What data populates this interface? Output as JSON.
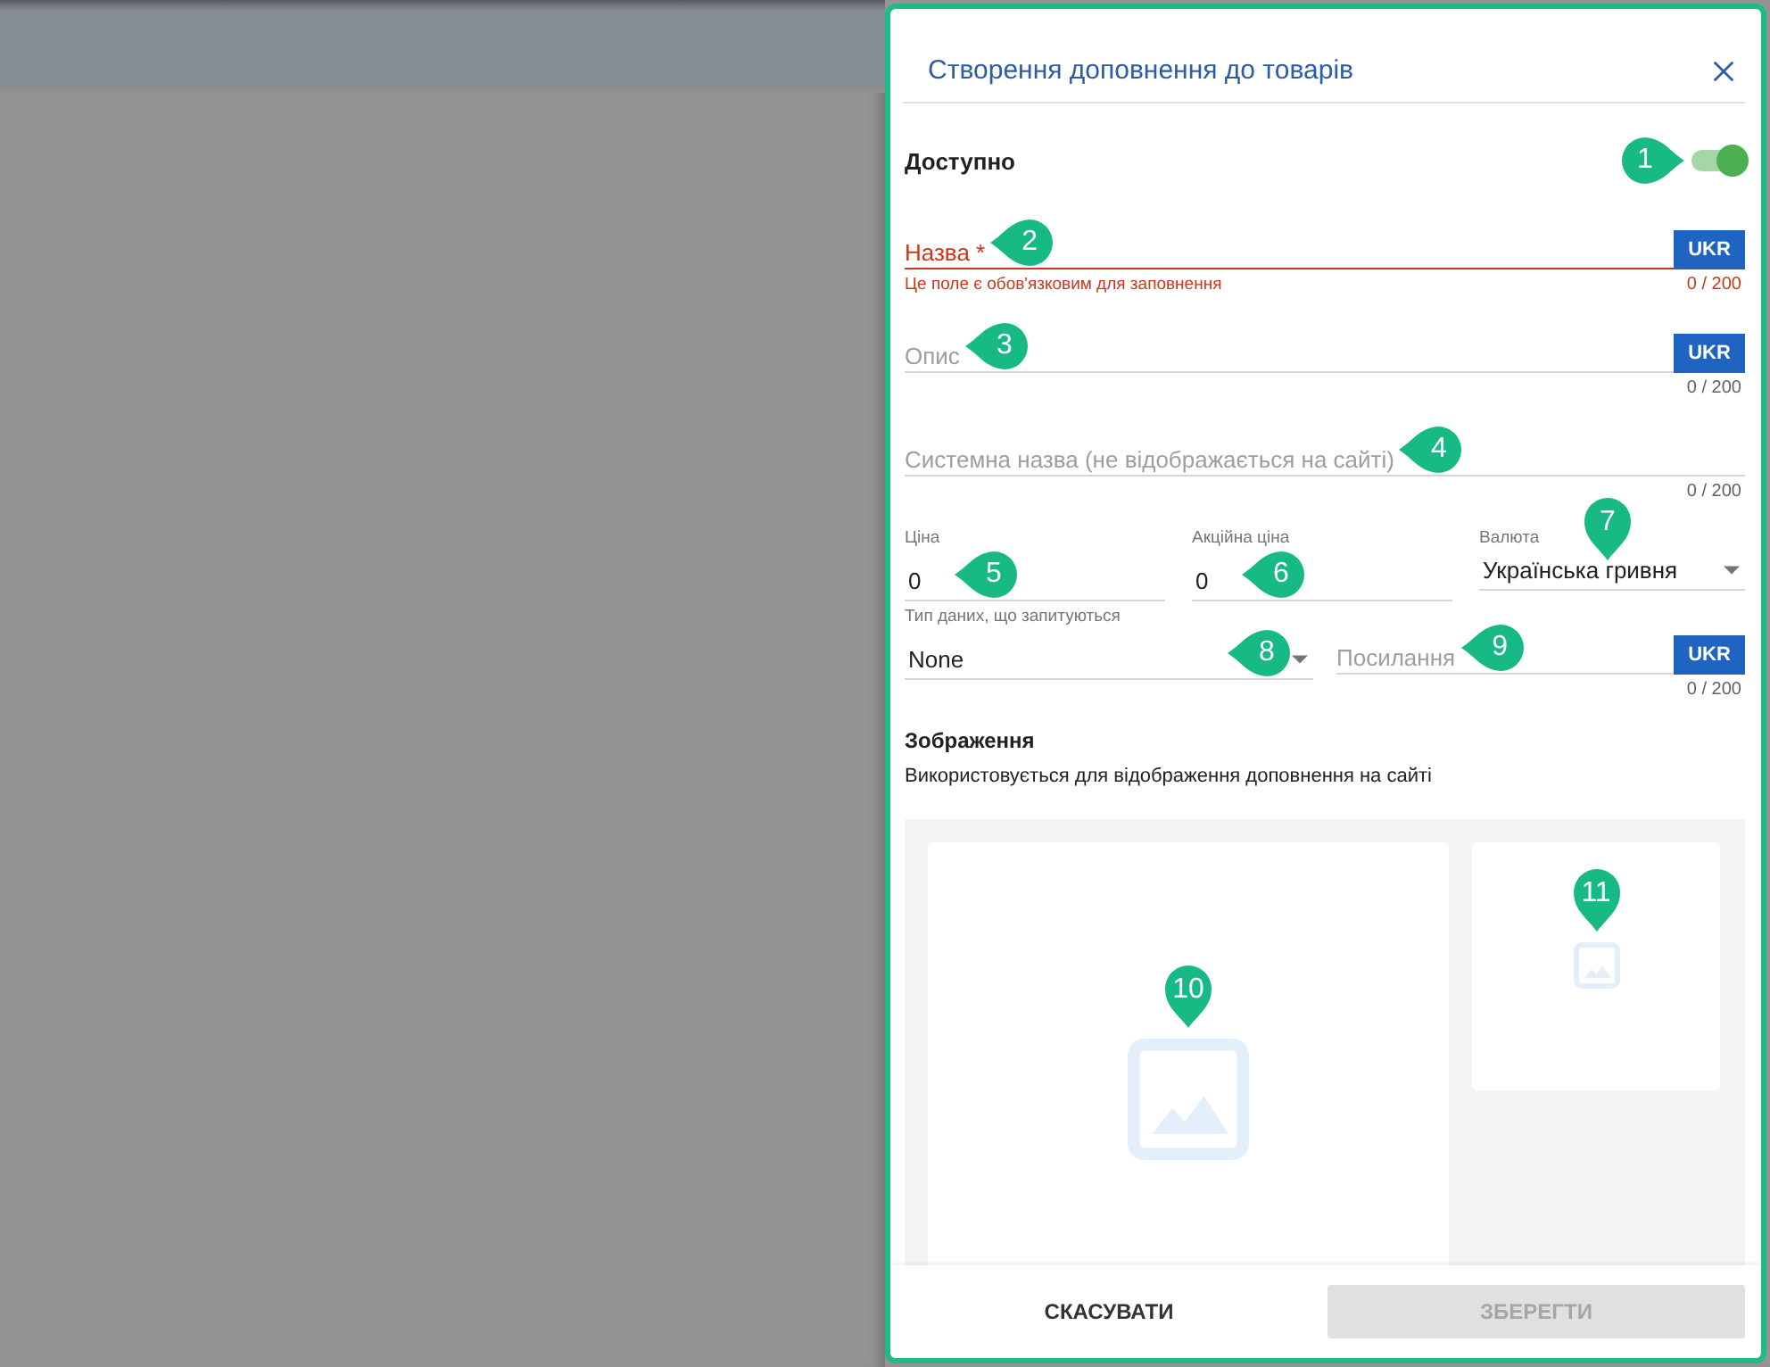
{
  "dialog": {
    "title": "Створення доповнення до товарів"
  },
  "available": {
    "label": "Доступно",
    "on": true,
    "callout": {
      "number": "1",
      "kind": "right"
    }
  },
  "fields": [
    {
      "label": "Назва *",
      "error": "Це поле є обов'язковим для заповнення",
      "counter": "0 / 200",
      "lang": "UKR",
      "callout": {
        "number": "2",
        "kind": "left"
      }
    },
    {
      "label": "Опис",
      "counter": "0 / 200",
      "lang": "UKR",
      "callout": {
        "number": "3",
        "kind": "left"
      }
    },
    {
      "label": "Системна назва (не відображається на сайті)",
      "counter": "0 / 200",
      "callout": {
        "number": "4",
        "kind": "left"
      }
    }
  ],
  "price_row": [
    {
      "kind": "input",
      "label": "Ціна",
      "value": "0",
      "callout": {
        "number": "5",
        "kind": "left"
      }
    },
    {
      "kind": "input",
      "label": "Акційна ціна",
      "value": "0",
      "callout": {
        "number": "6",
        "kind": "left"
      }
    },
    {
      "kind": "select",
      "label": "Валюта",
      "value": "Українська гривня",
      "callout": {
        "number": "7",
        "kind": "down"
      }
    }
  ],
  "data_type": {
    "label": "Тип даних, що запитуються",
    "value": "None",
    "callout": {
      "number": "8",
      "kind": "left"
    }
  },
  "link": {
    "placeholder": "Посилання",
    "lang": "UKR",
    "counter": "0 / 200",
    "callout": {
      "number": "9",
      "kind": "left"
    }
  },
  "images": {
    "title": "Зображення",
    "description": "Використовується для відображення доповнення на сайті",
    "main_callout": {
      "number": "10",
      "kind": "down"
    },
    "thumb_callout": {
      "number": "11",
      "kind": "down"
    }
  },
  "footer": {
    "cancel": "СКАСУВАТИ",
    "save": {
      "label": "ЗБЕРЕГТИ",
      "disabled": true
    }
  }
}
